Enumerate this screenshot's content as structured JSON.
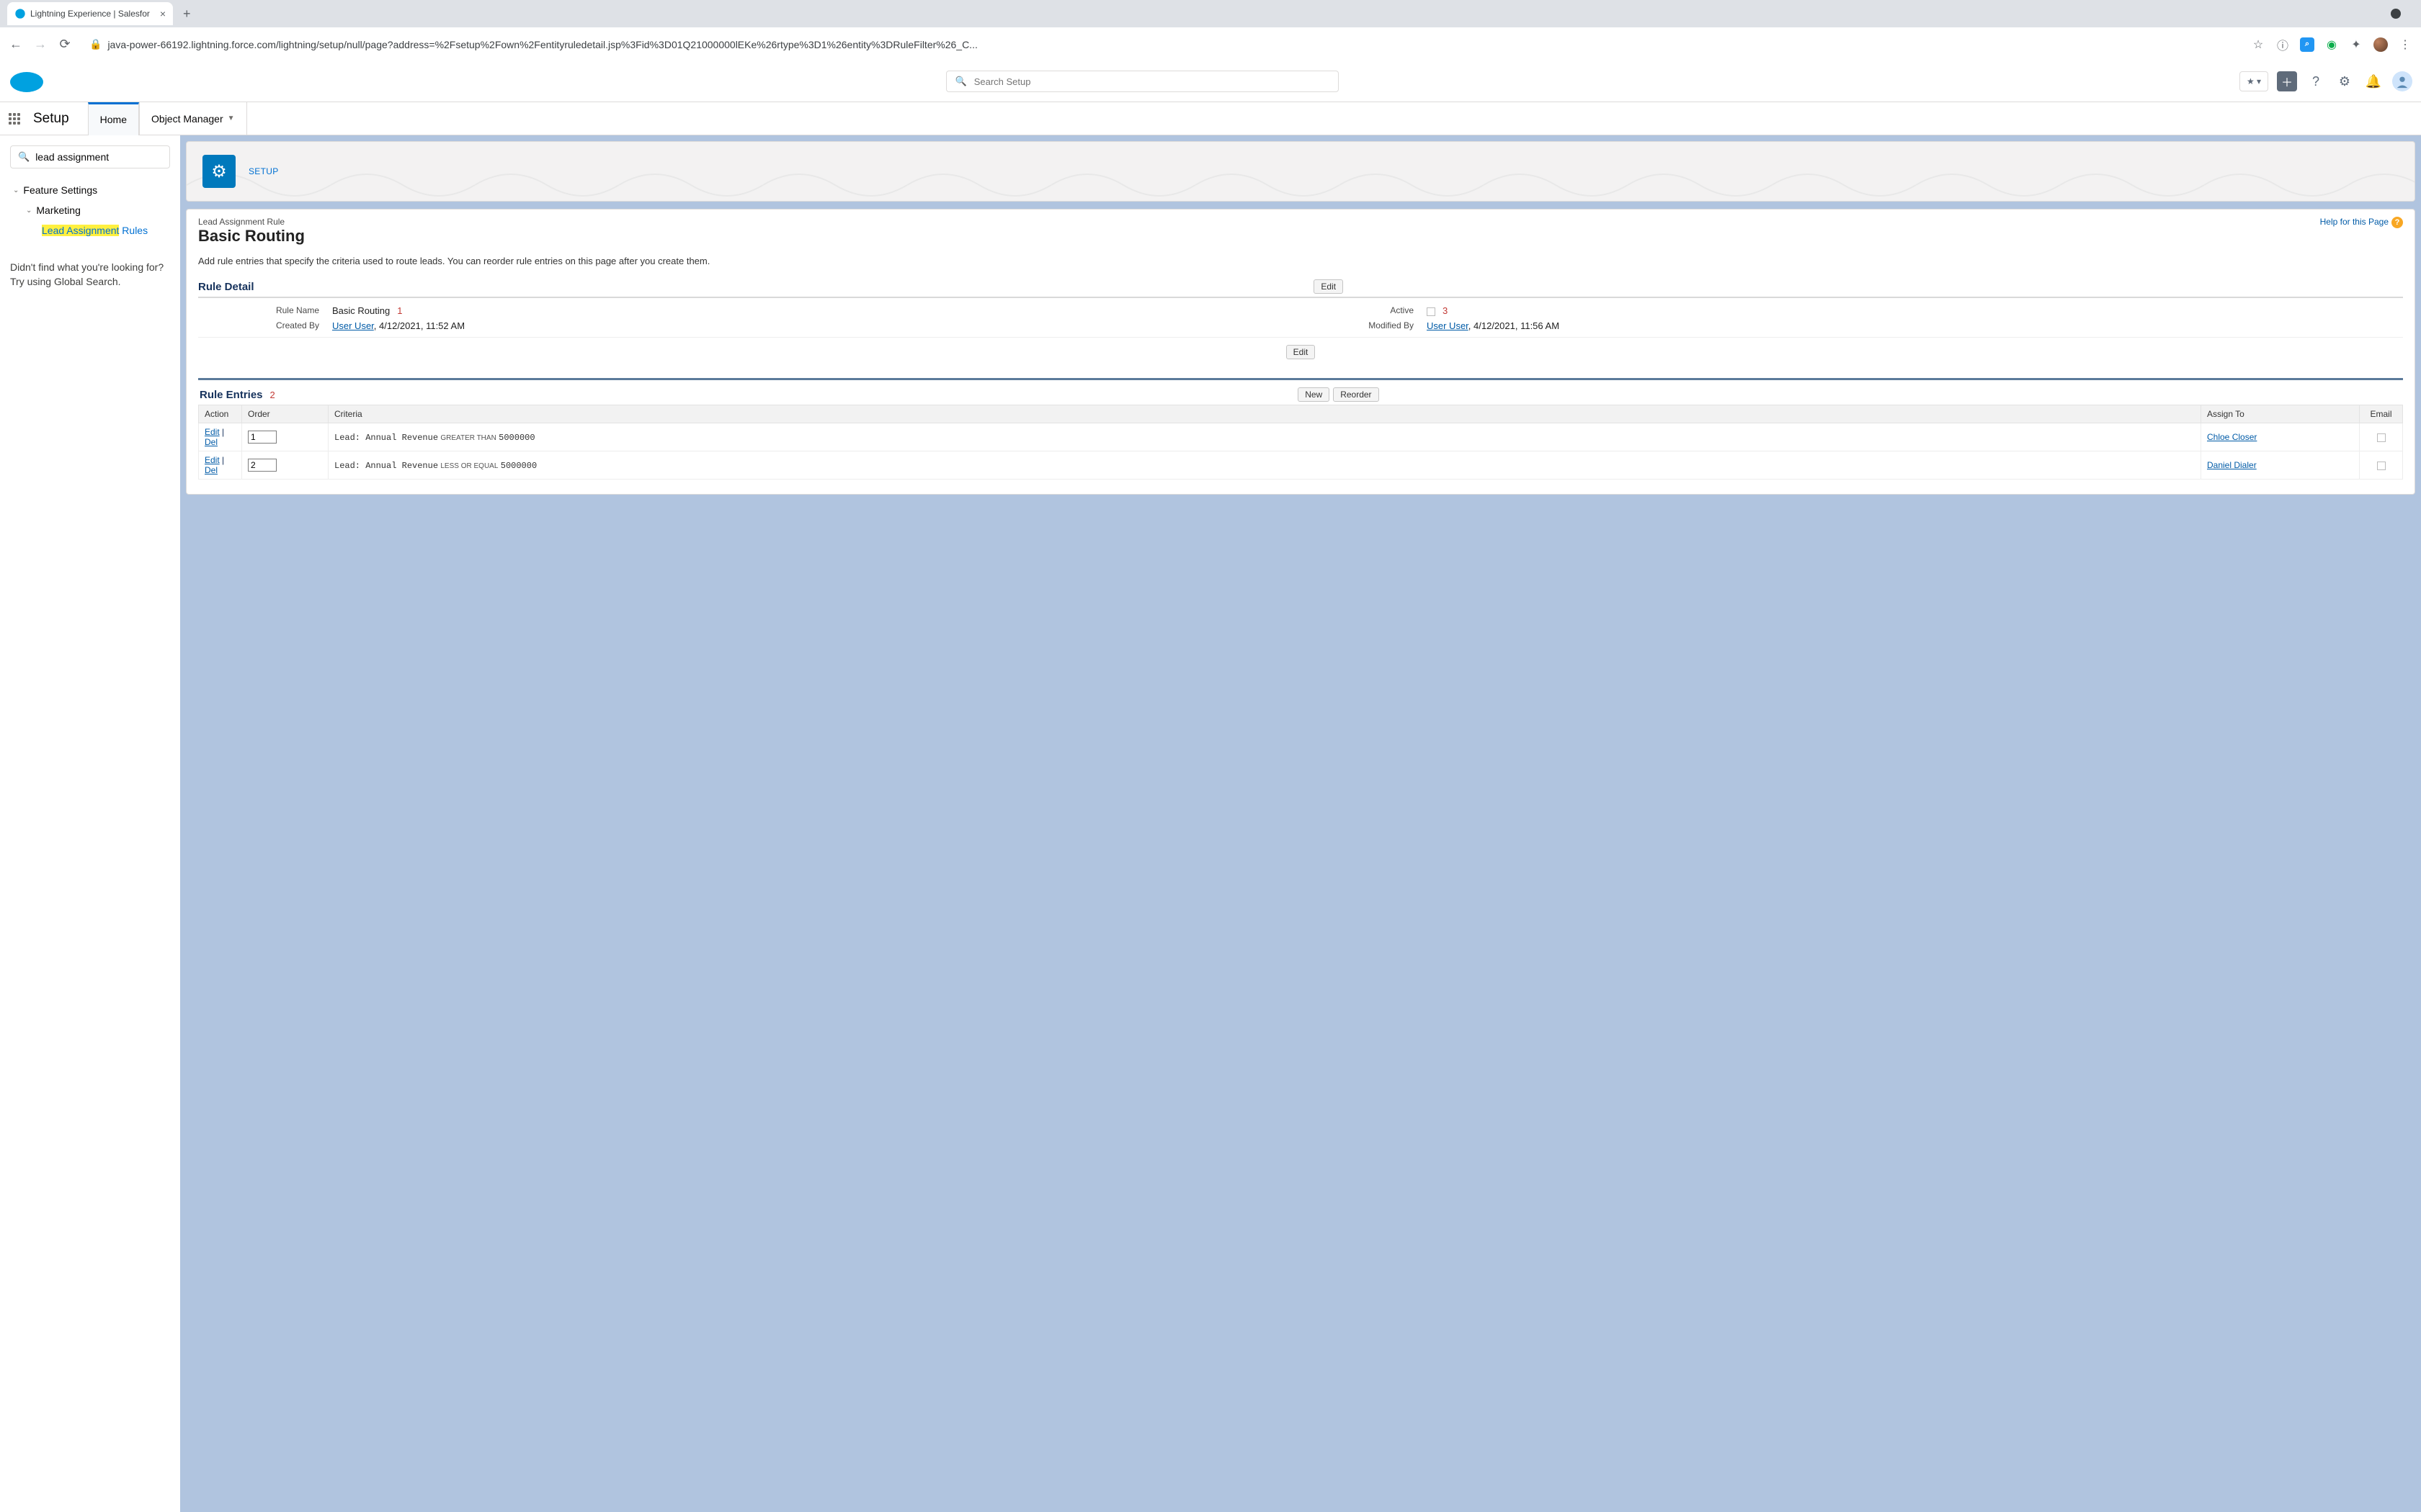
{
  "browser": {
    "tab_title": "Lightning Experience | Salesfor",
    "url": "java-power-66192.lightning.force.com/lightning/setup/null/page?address=%2Fsetup%2Fown%2Fentityruledetail.jsp%3Fid%3D01Q21000000lEKe%26rtype%3D1%26entity%3DRuleFilter%26_C..."
  },
  "searchPlaceholder": "Search Setup",
  "contextBar": {
    "appName": "Setup",
    "tabs": [
      "Home",
      "Object Manager"
    ]
  },
  "sidebar": {
    "quickFind": "lead assignment",
    "tree": {
      "l1": "Feature Settings",
      "l2": "Marketing",
      "l3_prefix": "Lead Assignment",
      "l3_suffix": " Rules"
    },
    "note": "Didn't find what you're looking for? Try using Global Search."
  },
  "pageHeader": {
    "label": "SETUP"
  },
  "detail": {
    "help": "Help for this Page",
    "crumb": "Lead Assignment Rule",
    "title": "Basic Routing",
    "descr": "Add rule entries that specify the criteria used to route leads. You can reorder rule entries on this page after you create them.",
    "sectionTitle": "Rule Detail",
    "editBtn": "Edit",
    "fields": {
      "ruleNameLabel": "Rule Name",
      "ruleName": "Basic Routing",
      "activeLabel": "Active",
      "createdByLabel": "Created By",
      "createdByUser": "User User",
      "createdByDate": ", 4/12/2021, 11:52 AM",
      "modifiedByLabel": "Modified By",
      "modifiedByUser": "User User",
      "modifiedByDate": ", 4/12/2021, 11:56 AM"
    },
    "annot1": "1",
    "annot2": "2",
    "annot3": "3"
  },
  "entries": {
    "title": "Rule Entries",
    "newBtn": "New",
    "reorderBtn": "Reorder",
    "headers": {
      "action": "Action",
      "order": "Order",
      "criteria": "Criteria",
      "assign": "Assign To",
      "email": "Email"
    },
    "actionEdit": "Edit",
    "actionDel": "Del",
    "rows": [
      {
        "order": "1",
        "field": "Lead: Annual Revenue",
        "op": "GREATER THAN",
        "val": "5000000",
        "assign": "Chloe Closer"
      },
      {
        "order": "2",
        "field": "Lead: Annual Revenue",
        "op": "LESS OR EQUAL",
        "val": "5000000",
        "assign": "Daniel Dialer"
      }
    ]
  }
}
